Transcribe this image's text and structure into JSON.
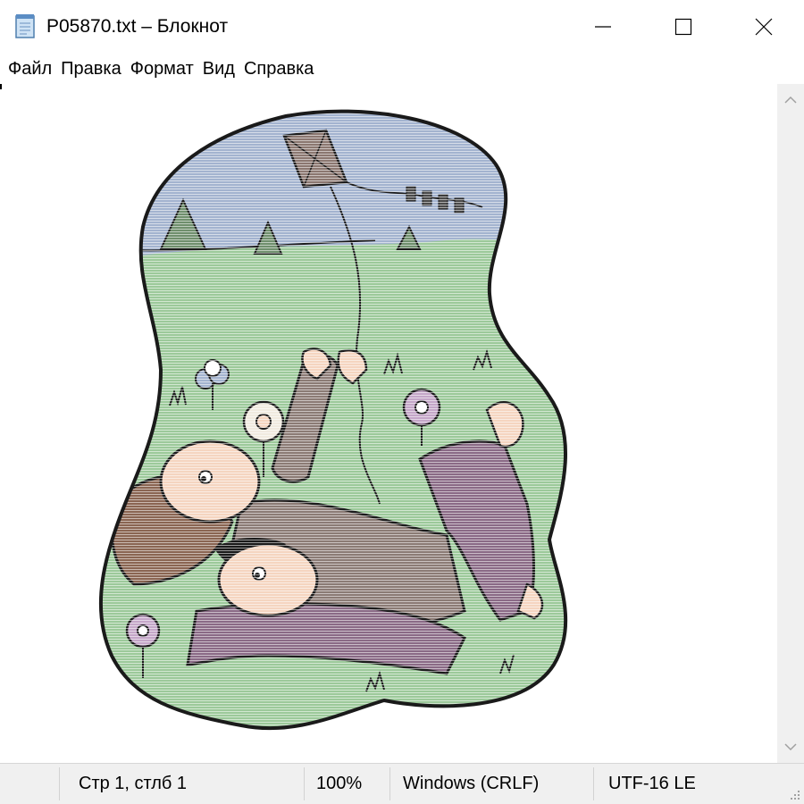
{
  "window": {
    "title": "P05870.txt – Блокнот",
    "icon": "notepad-icon",
    "controls": [
      "minimize-icon",
      "maximize-icon",
      "close-icon"
    ]
  },
  "menu": {
    "items": [
      "Файл",
      "Правка",
      "Формат",
      "Вид",
      "Справка"
    ]
  },
  "editor": {
    "content": "ASCII-art style colored illustration: two children lying in a meadow flying a kite, with trees, flowers and grass",
    "colors": {
      "sky": "#a3b3cf",
      "grass": "#9cc99a",
      "skin": "#f5d5c0",
      "sleeve": "#8b7b75",
      "pants": "#8a6a86",
      "hair": "#8a6552",
      "outline": "#1a1a1a"
    }
  },
  "scrollbar": {
    "up_icon": "chevron-up-icon",
    "down_icon": "chevron-down-icon"
  },
  "status": {
    "position": "Стр 1, стлб 1",
    "zoom": "100%",
    "line_endings": "Windows (CRLF)",
    "encoding": "UTF-16 LE"
  }
}
